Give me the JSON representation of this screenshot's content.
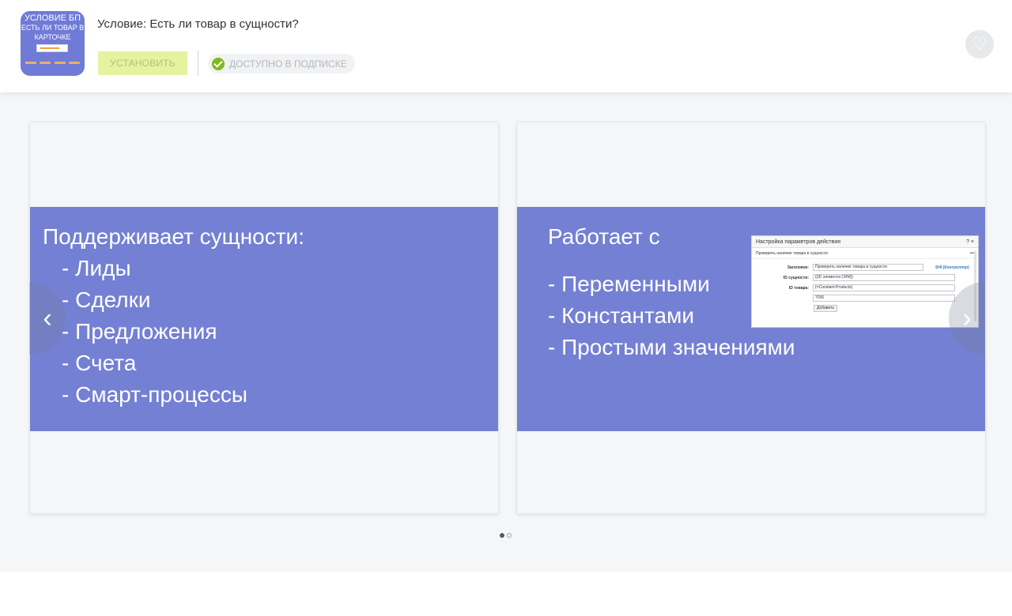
{
  "app": {
    "icon_text": {
      "line1": "УСЛОВИЕ БП",
      "line2": "ЕСТЬ ЛИ ТОВАР В",
      "line3": "КАРТОЧКЕ"
    },
    "title": "Условие: Есть ли товар в сущности?",
    "install_label": "УСТАНОВИТЬ",
    "subscription_label": "ДОСТУПНО В ПОДПИСКЕ"
  },
  "gallery": {
    "slides": [
      {
        "title": "Поддерживает сущности:",
        "bullets": [
          "- Лиды",
          "- Сделки",
          "- Предложения",
          "- Счета",
          "- Смарт-процессы"
        ]
      },
      {
        "title": "Работает с",
        "bullets": [
          "- Переменными",
          "- Константами",
          "- Простыми значениями"
        ],
        "dialog": {
          "title": "Настройка параметров действия",
          "header_controls": "? ×",
          "subtitle": "Проверить наличие товара в сущности",
          "subtitle_menu": "•••",
          "rows": [
            {
              "label": "Заголовок:",
              "value": "Проверить наличие товара в сущности",
              "link": "SHI (Контроллер)"
            },
            {
              "label": "ID сущности:",
              "value": "{{ID элемента CRM}}"
            },
            {
              "label": "ID товара:",
              "value": "{=Constant:Products}"
            },
            {
              "label": "",
              "value": "7036"
            }
          ],
          "add_label": "Добавить"
        }
      }
    ],
    "pagination": {
      "total": 2,
      "active": 0
    },
    "prev_glyph": "‹",
    "next_glyph": "›"
  },
  "icons": {
    "check": "check-circle-icon",
    "favorite": "heart-icon",
    "prev": "chevron-left-icon",
    "next": "chevron-right-icon"
  },
  "colors": {
    "accent_banner": "#7480d3",
    "install_bg": "#e4f39e",
    "check_green": "#7fba1e",
    "gallery_bg": "#f5f6f8"
  }
}
